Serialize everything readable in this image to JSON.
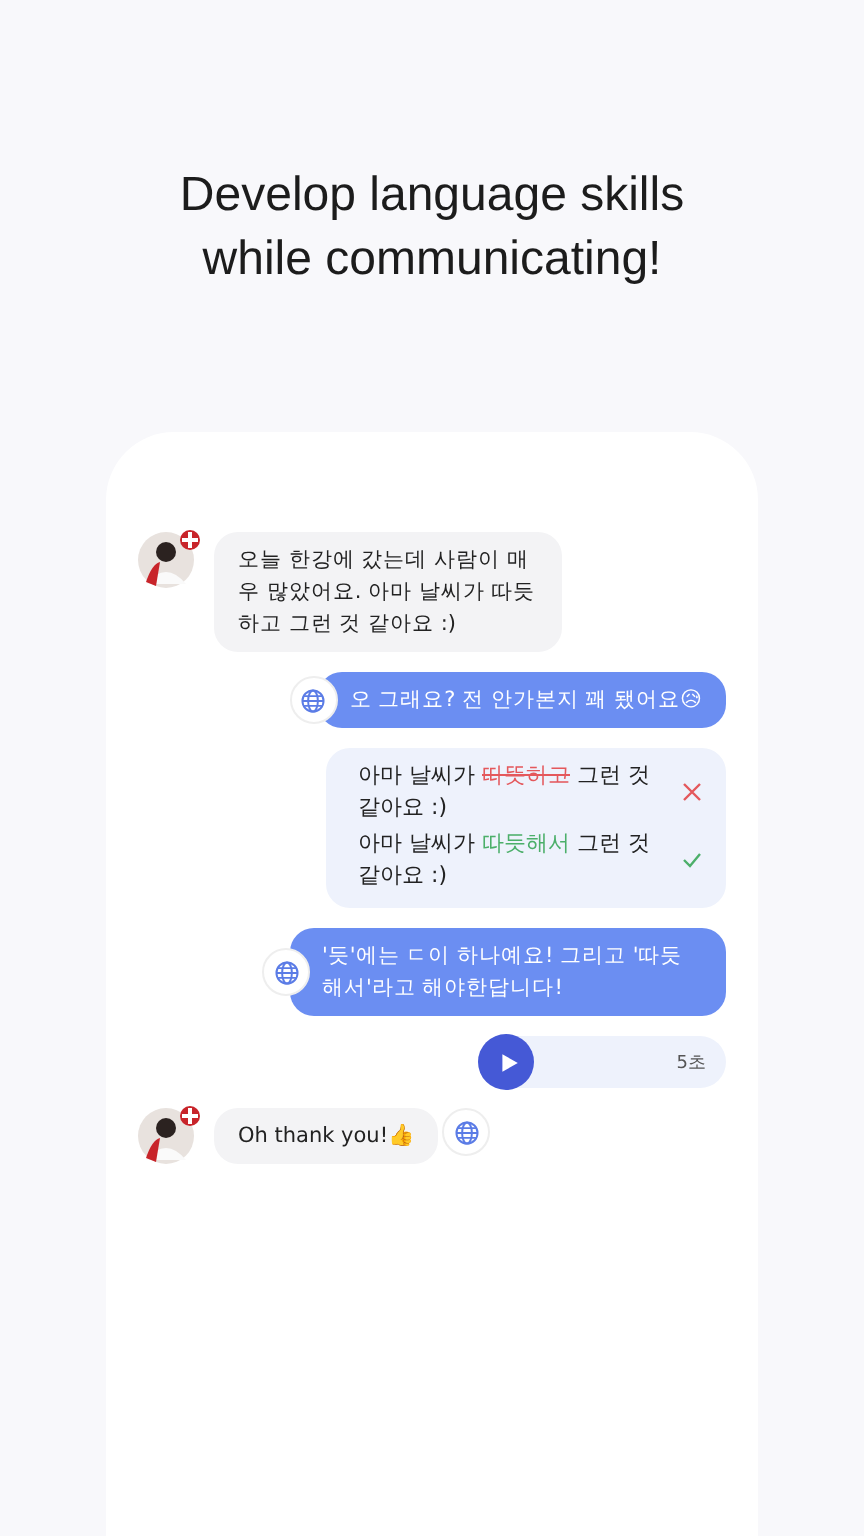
{
  "headline": [
    "Develop language skills",
    "while communicating!"
  ],
  "messages": [
    {
      "kind": "received",
      "text": "오늘 한강에 갔는데 사람이 매우 많았어요. 아마 날씨가 따듯하고 그런 것 같아요 :)",
      "translate": false
    },
    {
      "kind": "sent",
      "text": "오 그래요? 전 안가본지 꽤 됐어요😥",
      "translate": true
    },
    {
      "kind": "correction",
      "rows": [
        {
          "kind": "wrong",
          "segments": [
            {
              "kind": "plain",
              "text": "아마 날씨가 "
            },
            {
              "kind": "wrong",
              "text": "따뜻하고"
            },
            {
              "kind": "plain",
              "text": " 그런 것 같아요 :)"
            }
          ]
        },
        {
          "kind": "right",
          "segments": [
            {
              "kind": "plain",
              "text": "아마 날씨가 "
            },
            {
              "kind": "right",
              "text": "따듯해서"
            },
            {
              "kind": "plain",
              "text": " 그런 것 같아요 :)"
            }
          ]
        }
      ]
    },
    {
      "kind": "sent",
      "text": "'듯'에는 ㄷ이 하나예요! 그리고 '따듯해서'라고 해야한답니다!",
      "translate": true
    },
    {
      "kind": "voice",
      "duration": "5초"
    },
    {
      "kind": "received",
      "text": "Oh thank you!👍",
      "translate": true
    }
  ]
}
